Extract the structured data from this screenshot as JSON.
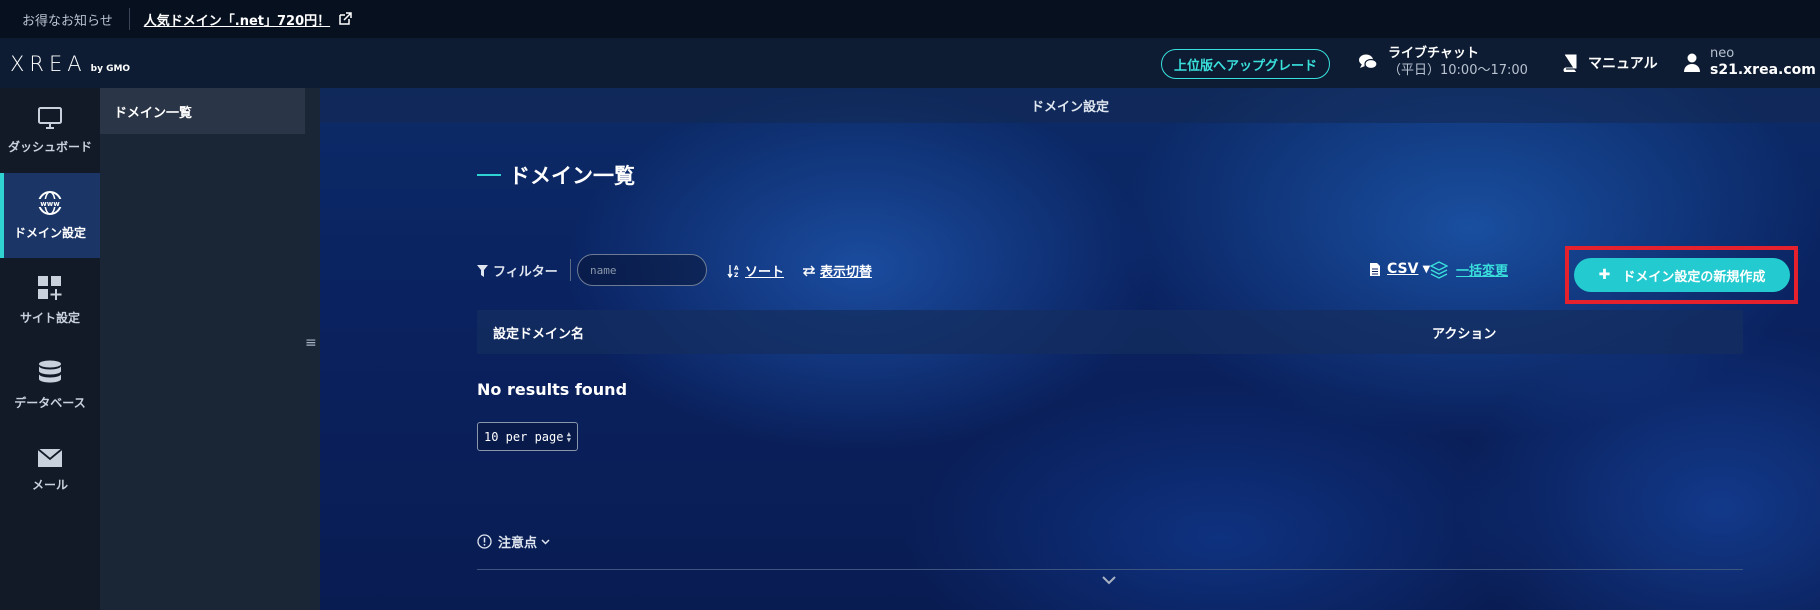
{
  "notice": {
    "lead": "お得なお知らせ",
    "link": "人気ドメイン「.net」720円！"
  },
  "header": {
    "logo": "XREA",
    "logo_by": "by GMO",
    "upgrade": "上位版へアップグレード",
    "chat_title": "ライブチャット",
    "chat_hours": "（平日）10:00〜17:00",
    "manual": "マニュアル",
    "user_name": "neo",
    "user_host": "s21.xrea.com"
  },
  "nav": {
    "items": [
      {
        "label": "ダッシュボード",
        "icon": "monitor-icon"
      },
      {
        "label": "ドメイン設定",
        "icon": "www-globe-icon"
      },
      {
        "label": "サイト設定",
        "icon": "grid-plus-icon"
      },
      {
        "label": "データベース",
        "icon": "database-icon"
      },
      {
        "label": "メール",
        "icon": "envelope-icon"
      }
    ]
  },
  "subnav": {
    "items": [
      {
        "label": "ドメイン一覧"
      }
    ]
  },
  "main": {
    "page_header": "ドメイン設定",
    "title": "ドメイン一覧",
    "filter_label": "フィルター",
    "filter_placeholder": "name",
    "sort_label": "ソート",
    "display_label": "表示切替",
    "csv_label": "CSV",
    "bulk_label": "一括変更",
    "create_label": "ドメイン設定の新規作成",
    "col_domain": "設定ドメイン名",
    "col_action": "アクション",
    "no_results": "No results found",
    "per_page": "10 per page",
    "notes_label": "注意点"
  },
  "colors": {
    "accent": "#2fd3d2",
    "create_button": "#23cbd0",
    "highlight_border": "#e4212c"
  }
}
